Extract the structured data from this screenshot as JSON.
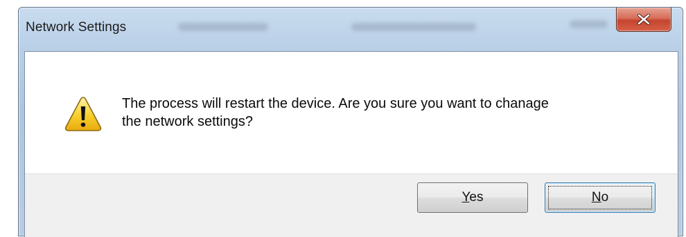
{
  "window": {
    "title": "Network Settings"
  },
  "dialog": {
    "message_line1": "The process will restart the device. Are you sure you want to chanage",
    "message_line2": "the network settings?",
    "icon": "warning-icon"
  },
  "buttons": {
    "yes_access_key": "Y",
    "yes_rest": "es",
    "no_access_key": "N",
    "no_rest": "o"
  },
  "colors": {
    "title_bar": "#b7cee6",
    "close_button": "#c4452e",
    "button_bar": "#f0f0f0",
    "focus_border": "#3c7fb1",
    "warning_yellow": "#f2c318"
  }
}
